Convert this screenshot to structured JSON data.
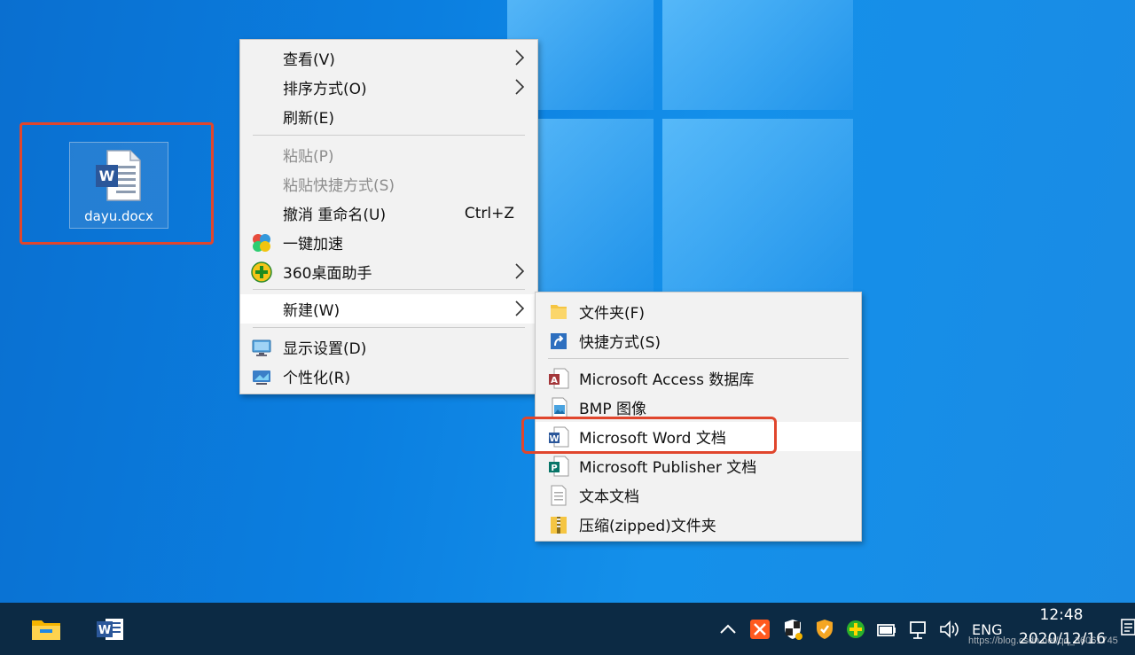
{
  "desktop": {
    "icon_name": "dayu.docx"
  },
  "context_menu": {
    "items": [
      {
        "label": "查看(V)",
        "has_submenu": true,
        "disabled": false
      },
      {
        "label": "排序方式(O)",
        "has_submenu": true,
        "disabled": false
      },
      {
        "label": "刷新(E)",
        "has_submenu": false,
        "disabled": false
      },
      {
        "label": "粘贴(P)",
        "has_submenu": false,
        "disabled": true
      },
      {
        "label": "粘贴快捷方式(S)",
        "has_submenu": false,
        "disabled": true
      },
      {
        "label": "撤消 重命名(U)",
        "shortcut": "Ctrl+Z",
        "has_submenu": false,
        "disabled": false
      },
      {
        "label": "一键加速",
        "icon": "speedup-icon",
        "has_submenu": false,
        "disabled": false
      },
      {
        "label": "360桌面助手",
        "icon": "360-assistant-icon",
        "has_submenu": true,
        "disabled": false
      },
      {
        "label": "新建(W)",
        "has_submenu": true,
        "disabled": false,
        "highlighted": true
      },
      {
        "label": "显示设置(D)",
        "icon": "display-icon",
        "has_submenu": false,
        "disabled": false
      },
      {
        "label": "个性化(R)",
        "icon": "personalize-icon",
        "has_submenu": false,
        "disabled": false
      }
    ]
  },
  "new_submenu": {
    "items": [
      {
        "label": "文件夹(F)",
        "icon": "folder-icon"
      },
      {
        "label": "快捷方式(S)",
        "icon": "shortcut-icon"
      },
      {
        "label": "Microsoft Access 数据库",
        "icon": "access-icon"
      },
      {
        "label": "BMP 图像",
        "icon": "bmp-icon"
      },
      {
        "label": "Microsoft Word 文档",
        "icon": "word-icon",
        "highlighted": true
      },
      {
        "label": "Microsoft Publisher 文档",
        "icon": "publisher-icon"
      },
      {
        "label": "文本文档",
        "icon": "text-document-icon"
      },
      {
        "label": "压缩(zipped)文件夹",
        "icon": "zip-folder-icon"
      }
    ]
  },
  "taskbar": {
    "pinned": [
      "file-explorer-icon",
      "word-icon"
    ],
    "tray_icons": [
      "show-hidden-icons-chevron",
      "app-tray-icon",
      "security-shield-icon",
      "shield-icon",
      "360-icon",
      "battery-icon",
      "network-icon",
      "volume-icon"
    ],
    "language": "ENG",
    "time": "12:48",
    "date": "2020/12/16",
    "watermark": "https://blog.csdn.net/qq_36061745"
  },
  "colors": {
    "highlight_border": "#e0462d",
    "taskbar_bg": "#0c2a44",
    "menu_bg": "#f2f2f2",
    "word_blue": "#2b579a"
  }
}
